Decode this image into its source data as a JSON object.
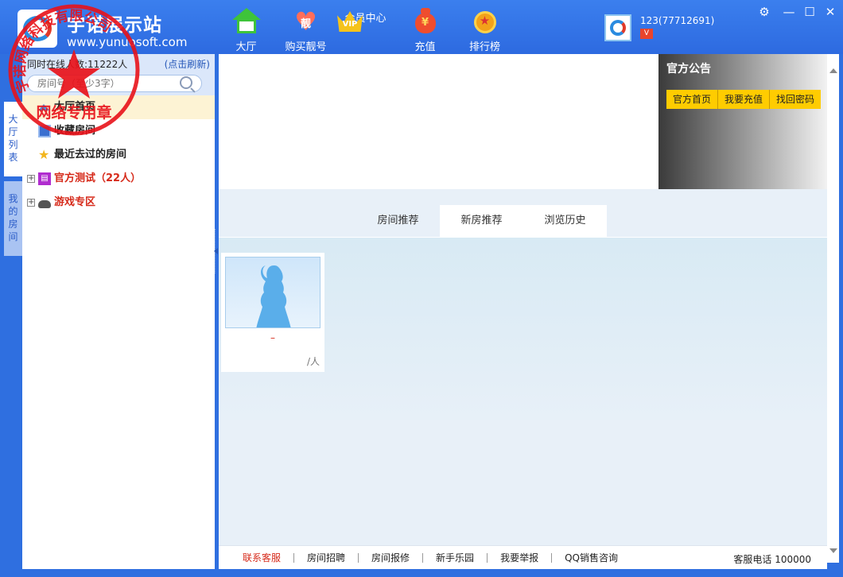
{
  "header": {
    "title": "宇诺展示站",
    "url": "www.yunuosoft.com",
    "nav": [
      {
        "label": "大厅",
        "icon": "house-icon"
      },
      {
        "label": "购买靓号",
        "icon": "heart-icon",
        "badge": "靓"
      },
      {
        "label": "会员中心",
        "icon": "crown-icon",
        "badge": "VIP"
      },
      {
        "label": "充值",
        "icon": "money-bag-icon",
        "badge": "¥"
      },
      {
        "label": "排行榜",
        "icon": "medal-icon",
        "badge": "★"
      }
    ],
    "user": {
      "name": "123(77712691)",
      "badge": "V"
    },
    "window_controls": {
      "settings": "⚙",
      "minimize": "—",
      "maximize": "☐",
      "close": "✕"
    }
  },
  "sidebar": {
    "tabs": [
      {
        "label": "大厅列表",
        "active": true
      },
      {
        "label": "我的房间",
        "active": false
      }
    ],
    "online_text": "同时在线人数:11222人",
    "refresh_label": "(点击刷新)",
    "search_placeholder": "房间号（至少3字）",
    "items": [
      {
        "label": "大厅首页",
        "icon": "home-icon",
        "selected": true
      },
      {
        "label": "收藏房间",
        "icon": "favorite-icon"
      },
      {
        "label": "最近去过的房间",
        "icon": "star-icon"
      },
      {
        "label": "官方测试（22人）",
        "icon": "test-icon",
        "expander": "+"
      },
      {
        "label": "游戏专区",
        "icon": "gamepad-icon",
        "expander": "+"
      }
    ]
  },
  "notice": {
    "title": "官方公告",
    "links": [
      "官方首页",
      "我要充值",
      "找回密码"
    ]
  },
  "content": {
    "tabs": [
      {
        "label": "房间推荐",
        "active": true
      },
      {
        "label": "新房推荐",
        "active": false
      },
      {
        "label": "浏览历史",
        "active": false
      }
    ],
    "rooms": [
      {
        "name": "–",
        "count": "/人"
      }
    ]
  },
  "footer": {
    "links": [
      "联系客服",
      "房间招聘",
      "房间报修",
      "新手乐园",
      "我要举报",
      "QQ销售咨询"
    ],
    "hotline": "客服电话 100000"
  },
  "stamp": {
    "ring_text": "宇诺网络科技有限公司",
    "center_text": "网络专用章",
    "color": "#e8121a"
  },
  "colors": {
    "frame_blue": "#2f6fe0",
    "notice_button": "#ffcc00",
    "accent_red": "#d62a1a"
  }
}
